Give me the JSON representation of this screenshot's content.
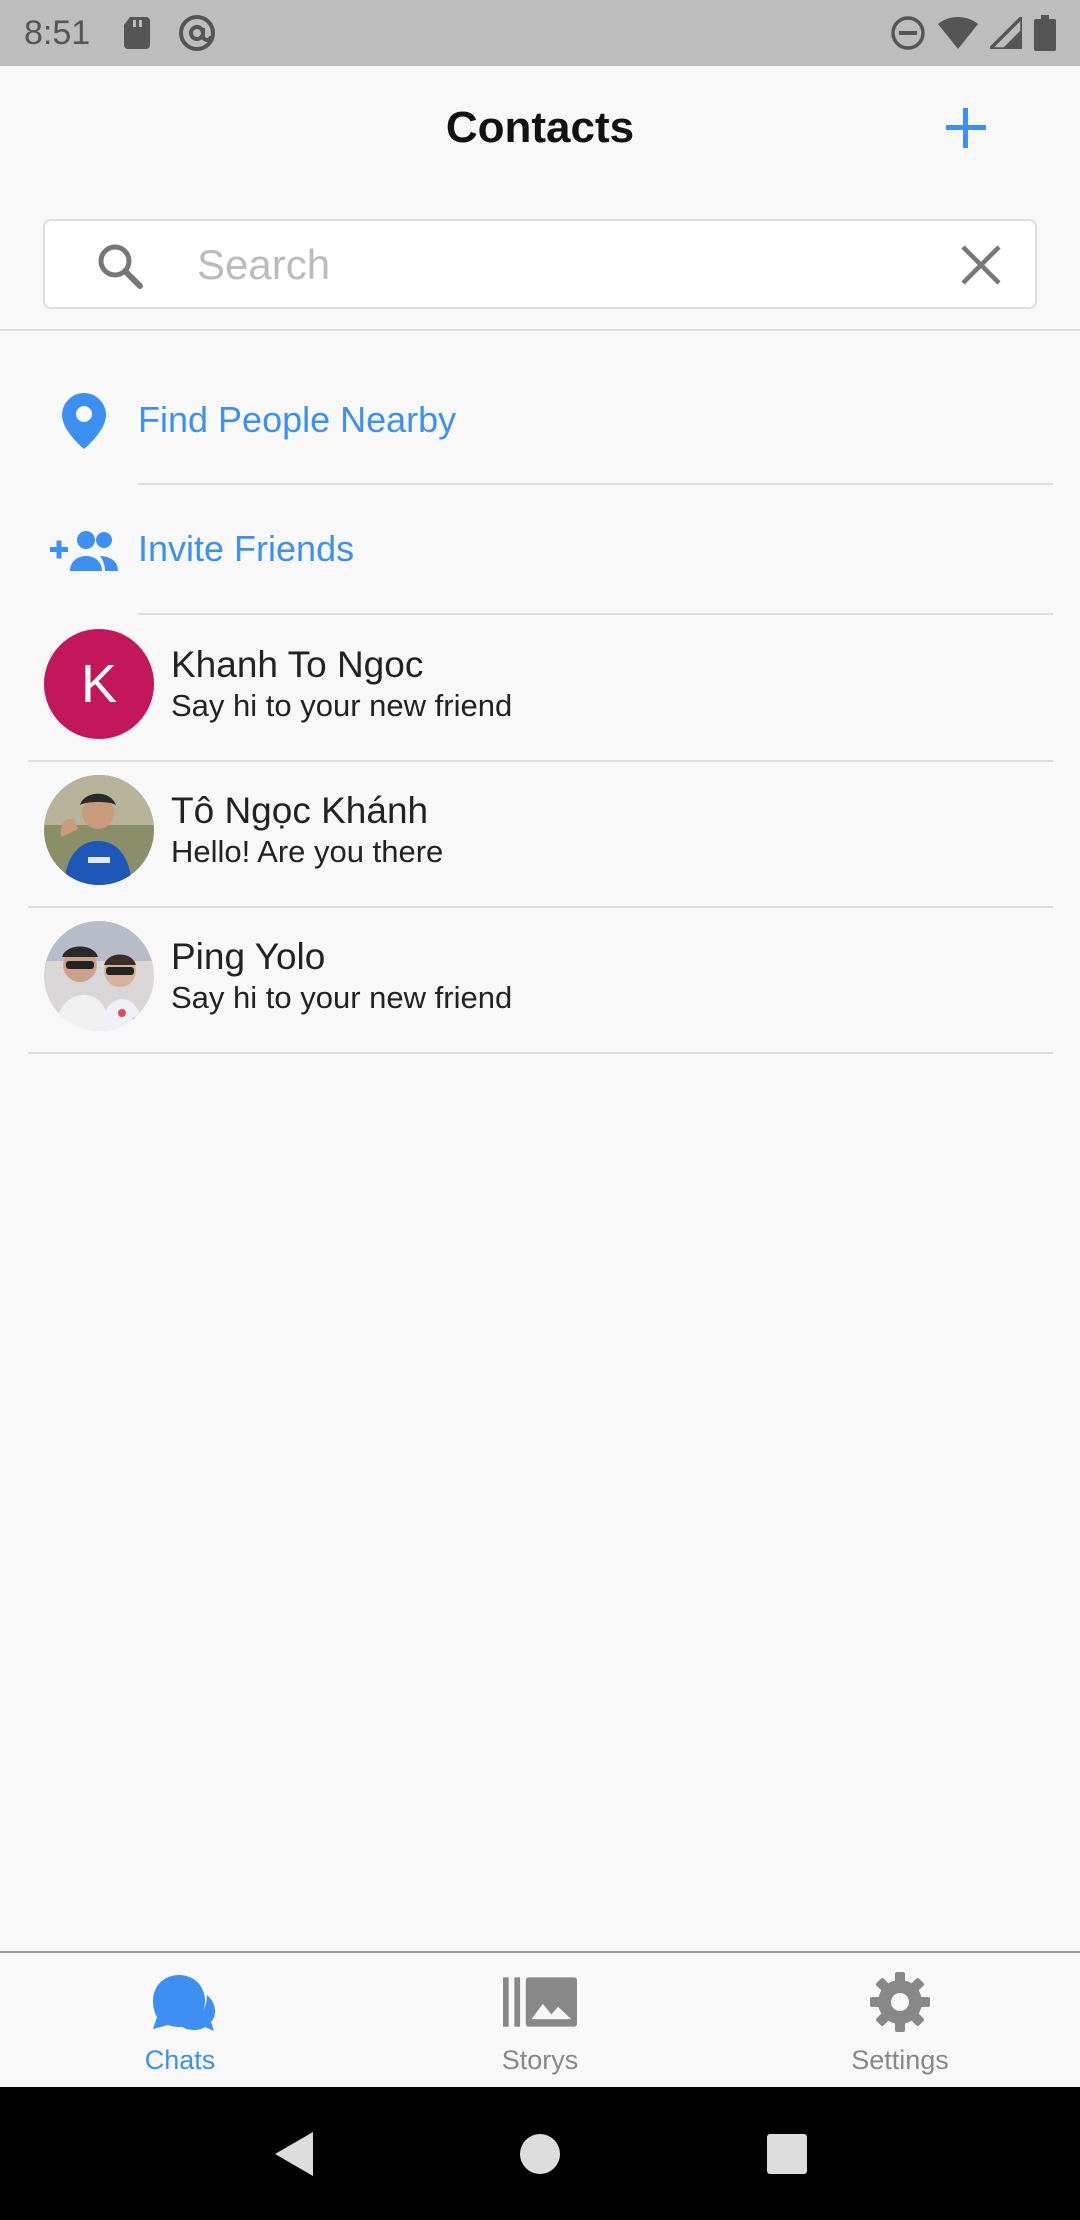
{
  "status_bar": {
    "time": "8:51"
  },
  "header": {
    "title": "Contacts",
    "add_icon": "plus-icon"
  },
  "search": {
    "placeholder": "Search",
    "value": ""
  },
  "actions": [
    {
      "label": "Find People Nearby",
      "icon": "location-pin-icon"
    },
    {
      "label": "Invite Friends",
      "icon": "add-group-icon"
    }
  ],
  "contacts": [
    {
      "name": "Khanh To Ngoc",
      "message": "Say hi to your new friend",
      "avatar_letter": "K"
    },
    {
      "name": "Tô Ngọc Khánh",
      "message": "Hello! Are you there",
      "avatar_letter": ""
    },
    {
      "name": "Ping Yolo",
      "message": "Say hi to your new friend",
      "avatar_letter": ""
    }
  ],
  "bottom_nav": [
    {
      "label": "Chats",
      "icon": "chat-bubbles-icon",
      "active": true
    },
    {
      "label": "Storys",
      "icon": "gallery-icon",
      "active": false
    },
    {
      "label": "Settings",
      "icon": "gear-icon",
      "active": false
    }
  ],
  "colors": {
    "accent": "#3d8ff2",
    "avatar_k": "#c2185b",
    "status_bar": "#bdbdbd"
  }
}
